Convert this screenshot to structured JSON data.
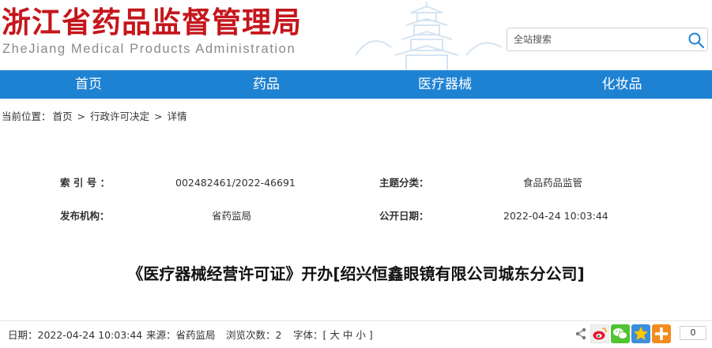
{
  "header": {
    "title": "浙江省药品监督管理局",
    "subtitle": "ZheJiang Medical Products Administration",
    "search_placeholder": "全站搜索"
  },
  "nav": {
    "items": [
      {
        "label": "首页"
      },
      {
        "label": "药品"
      },
      {
        "label": "医疗器械"
      },
      {
        "label": "化妆品"
      }
    ]
  },
  "breadcrumb": {
    "prefix": "当前位置：",
    "items": [
      "首页",
      "行政许可决定",
      "详情"
    ],
    "separator": ">"
  },
  "meta": {
    "index_label": "索 引 号 ：",
    "index_value": "002482461/2022-46691",
    "topic_label": "主题分类：",
    "topic_value": "食品药品监管",
    "issuer_label": "发布机构：",
    "issuer_value": "省药监局",
    "date_label": "公开日期：",
    "date_value": "2022-04-24 10:03:44"
  },
  "article": {
    "title": "《医疗器械经营许可证》开办[绍兴恒鑫眼镜有限公司城东分公司]"
  },
  "info": {
    "date": "日期：2022-04-24 10:03:44",
    "source": "来源：省药监局",
    "views": "浏览次数：2",
    "font_prefix": "字体：[",
    "font_large": "大",
    "font_medium": "中",
    "font_small": "小",
    "font_suffix": "]"
  },
  "share": {
    "icons": [
      "share-icon",
      "weibo-icon",
      "wechat-icon",
      "qzone-icon",
      "more-icon"
    ],
    "count": "0"
  },
  "colors": {
    "brand_red": "#c4161c",
    "nav_blue": "#1e82d2"
  }
}
